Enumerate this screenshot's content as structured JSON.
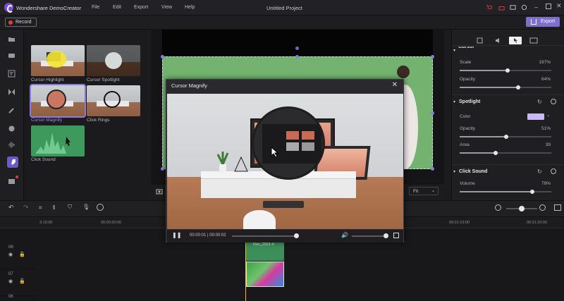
{
  "app": {
    "name": "Wondershare DemoCreator",
    "project_title": "Untitled Project"
  },
  "menu": [
    "File",
    "Edit",
    "Export",
    "View",
    "Help"
  ],
  "toolbar": {
    "record_label": "Record",
    "export_label": "Export"
  },
  "effects": [
    {
      "label": "Cursor Highlight"
    },
    {
      "label": "Cursor Spotlight"
    },
    {
      "label": "Cursor Magnify"
    },
    {
      "label": "Click Rings"
    },
    {
      "label": "Click Sound"
    }
  ],
  "preview": {
    "fit_label": "Fit"
  },
  "right_panel": {
    "cursor_section_label": "Cursor",
    "scale_label": "Scale",
    "scale_value": "197%",
    "scale_frac": 0.52,
    "opacity_label": "Opacity",
    "opacity_value": "64%",
    "opacity_frac": 0.64,
    "spotlight_label": "Spotlight",
    "color_label": "Color",
    "sp_opacity_label": "Opacity",
    "sp_opacity_value": "51%",
    "sp_opacity_frac": 0.51,
    "area_label": "Area",
    "area_value": "39",
    "area_frac": 0.39,
    "click_sound_label": "Click Sound",
    "volume_label": "Volume",
    "volume_value": "79%",
    "volume_frac": 0.79,
    "swatch_color": "#c9b8f3"
  },
  "timeline": {
    "ruler": [
      "3:10:00",
      "00:00:20:00",
      "00:01:10:00",
      "00:01:20:00"
    ],
    "tracks": [
      "08",
      "07",
      "06"
    ],
    "clip_title": "Rec_2021-0"
  },
  "modal": {
    "title": "Cursor Magnify",
    "time": "00:00:01 | 00:00:02"
  },
  "colors": {
    "accent": "#7d6fce",
    "playhead": "#f0c030",
    "green_screen": "#74b36f"
  }
}
